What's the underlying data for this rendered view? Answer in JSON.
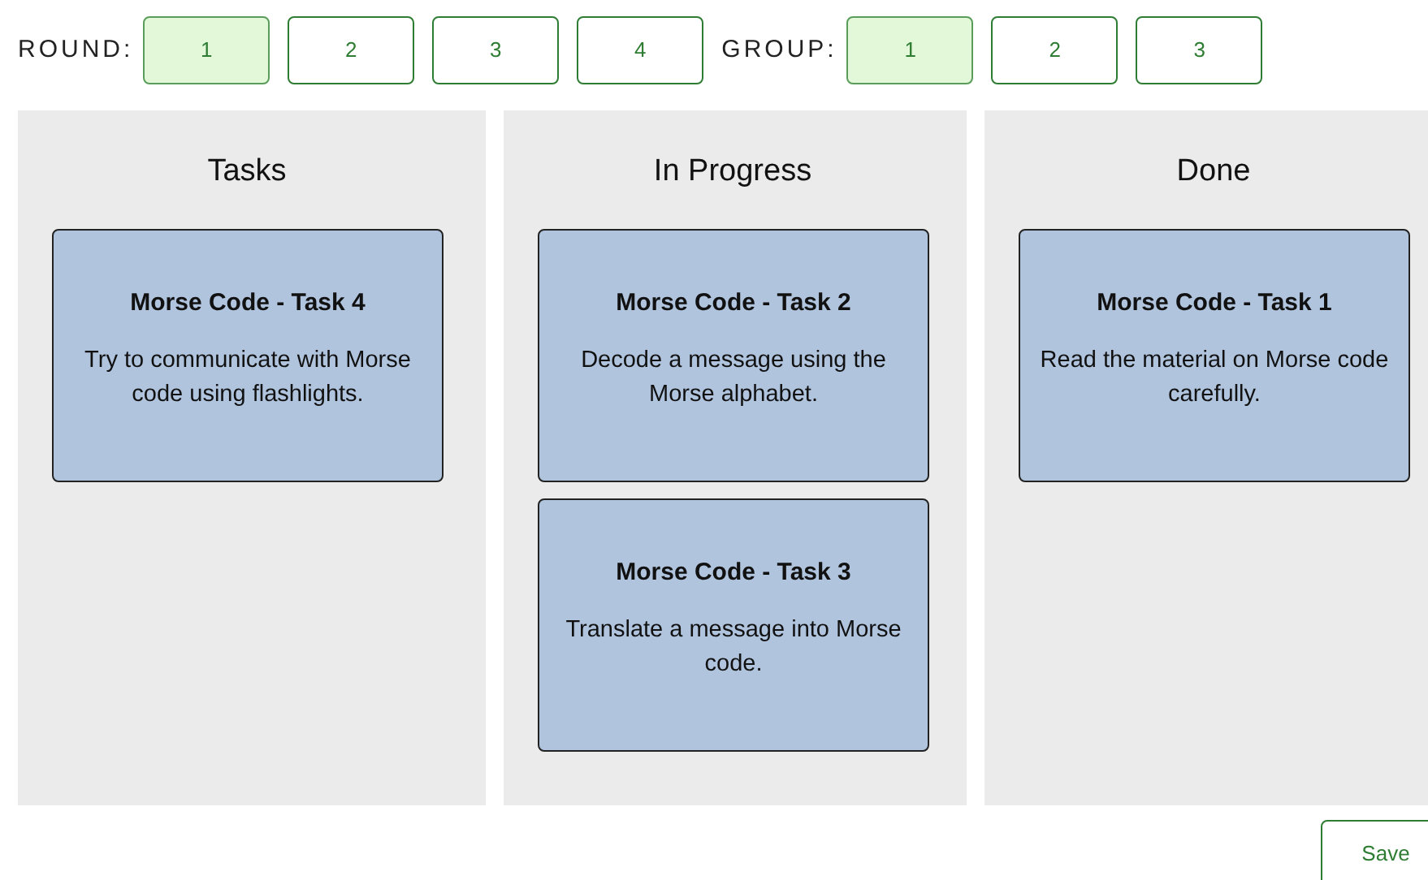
{
  "round": {
    "label": "ROUND:",
    "options": [
      {
        "label": "1",
        "selected": true
      },
      {
        "label": "2",
        "selected": false
      },
      {
        "label": "3",
        "selected": false
      },
      {
        "label": "4",
        "selected": false
      }
    ]
  },
  "group": {
    "label": "GROUP:",
    "options": [
      {
        "label": "1",
        "selected": true
      },
      {
        "label": "2",
        "selected": false
      },
      {
        "label": "3",
        "selected": false
      }
    ]
  },
  "columns": [
    {
      "title": "Tasks",
      "cards": [
        {
          "title": "Morse Code - Task 4",
          "description": "Try to communicate with Morse code using flashlights."
        }
      ]
    },
    {
      "title": "In Progress",
      "cards": [
        {
          "title": "Morse Code - Task 2",
          "description": "Decode a message using the Morse alphabet."
        },
        {
          "title": "Morse Code - Task 3",
          "description": "Translate a message into Morse code."
        }
      ]
    },
    {
      "title": "Done",
      "cards": [
        {
          "title": "Morse Code - Task 1",
          "description": "Read the material on Morse code carefully."
        }
      ]
    }
  ],
  "save_button": "Save"
}
